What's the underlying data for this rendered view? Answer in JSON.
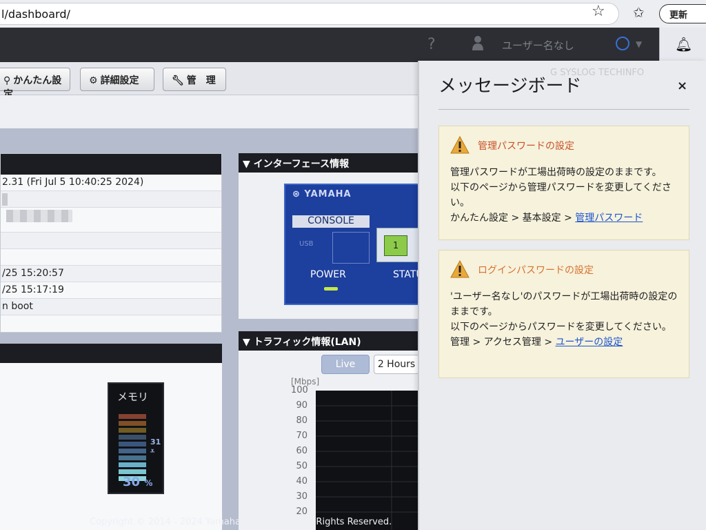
{
  "browser": {
    "url": "l/dashboard/",
    "update_label": "更新"
  },
  "header": {
    "help": "?",
    "user_name": "ユーザー名なし"
  },
  "toolbar": {
    "easy_setup": "かんたん設定",
    "detail_setup": "詳細設定",
    "manage": "管　理"
  },
  "system_info": {
    "rows": [
      "2.31 (Fri Jul 5 10:40:25 2024)",
      "",
      "",
      "",
      "",
      "/25 15:20:57",
      "/25 15:17:19",
      "n boot"
    ]
  },
  "interface": {
    "title": "インターフェース情報",
    "brand": "YAMAHA",
    "console": "CONSOLE",
    "usb": "USB",
    "lan_port": "1",
    "power": "POWER",
    "status": "STATU"
  },
  "resources": {
    "memory_label": "メモリ",
    "memory_mark": "31",
    "memory_percent": "30",
    "percent_unit": "%",
    "memory_level": 0.3
  },
  "traffic": {
    "title": "トラフィック情報(LAN)",
    "live_label": "Live",
    "hours_label": "2 Hours",
    "unit": "[Mbps]",
    "ticks": [
      "100",
      "90",
      "80",
      "70",
      "60",
      "50",
      "40",
      "30",
      "20"
    ]
  },
  "footer": {
    "copyright": "Copyright © 2014 - 2024 Yamaha Corporation. All Rights Reserved."
  },
  "message_board": {
    "title": "メッセージボード",
    "ghost_tabs": "G  SYSLOG  TECHINFO",
    "close": "×",
    "messages": [
      {
        "title": "管理パスワードの設定",
        "body_1": "管理パスワードが工場出荷時の設定のままです。",
        "body_2": "以下のページから管理パスワードを変更してください。",
        "path": "かんたん設定 > 基本設定 > ",
        "link": "管理パスワード"
      },
      {
        "title": "ログインパスワードの設定",
        "body_1": "'ユーザー名なし'のパスワードが工場出荷時の設定のままです。",
        "body_2": "以下のページからパスワードを変更してください。",
        "path": "管理 > アクセス管理 > ",
        "link": "ユーザーの設定"
      }
    ]
  },
  "colors": {
    "warning_title": "#c9512a",
    "link": "#1e55cf",
    "device_blue": "#1d3f9e",
    "lan_active": "#8ccb4a"
  }
}
